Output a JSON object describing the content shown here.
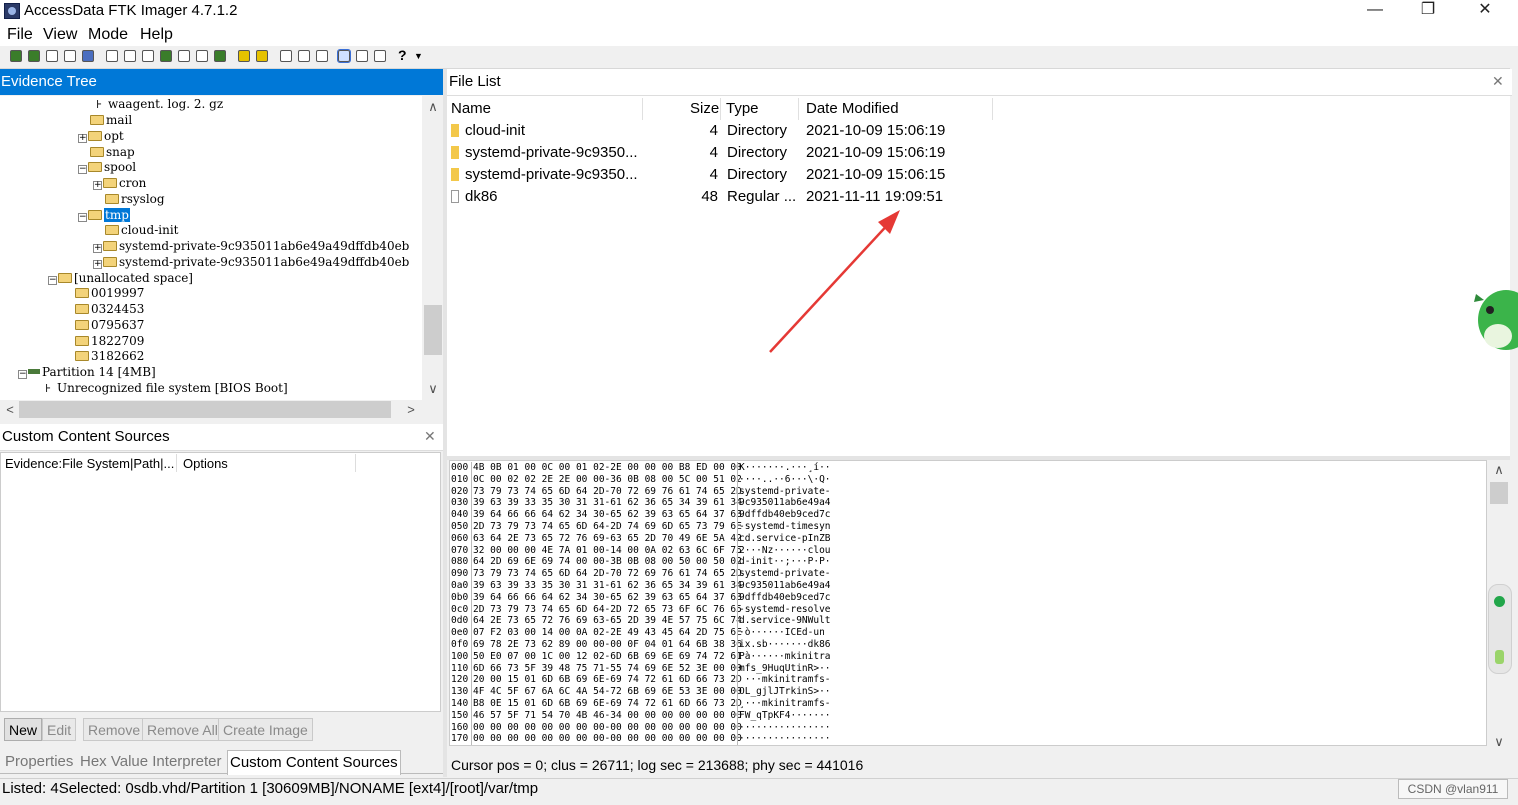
{
  "window": {
    "title": "AccessData FTK Imager 4.7.1.2",
    "minimize": "—",
    "maximize": "❐",
    "close": "✕"
  },
  "menu": [
    "File",
    "View",
    "Mode",
    "Help"
  ],
  "toolbar": {
    "icons": [
      "add-evidence-icon",
      "add-all-evidence-icon",
      "image-mounting-icon",
      "remove-evidence-icon",
      "remove-all-icon",
      "create-image-icon",
      "export-disk-image-icon",
      "export-logical-image-icon",
      "add-custom-content-icon",
      "create-custom-image-icon",
      "decrypt-icon",
      "verify-drive-icon",
      "capture-memory-icon",
      "obtain-protected-files-icon",
      "detect-encryption-icon",
      "export-files-icon",
      "export-hash-list-icon",
      "export-directory-listing-icon",
      "view-files-icon",
      "view-text-icon",
      "view-hex-icon",
      "help-icon"
    ]
  },
  "evidence_tree": {
    "title": "Evidence Tree",
    "nodes": [
      {
        "label": "waagent. log. 2. gz"
      },
      {
        "label": "mail"
      },
      {
        "label": "opt"
      },
      {
        "label": "snap"
      },
      {
        "label": "spool"
      },
      {
        "label": "cron"
      },
      {
        "label": "rsyslog"
      },
      {
        "label": "tmp"
      },
      {
        "label": "cloud-init"
      },
      {
        "label": "systemd-private-9c935011ab6e49a49dffdb40eb"
      },
      {
        "label": "systemd-private-9c935011ab6e49a49dffdb40eb"
      },
      {
        "label": "[unallocated space]"
      },
      {
        "label": "0019997"
      },
      {
        "label": "0324453"
      },
      {
        "label": "0795637"
      },
      {
        "label": "1822709"
      },
      {
        "label": "3182662"
      },
      {
        "label": "Partition 14 [4MB]"
      },
      {
        "label": "Unrecognized file system [BIOS Boot]"
      }
    ]
  },
  "custom_content": {
    "title": "Custom Content Sources",
    "col_evidence": "Evidence:File System|Path|...",
    "col_options": "Options",
    "buttons": [
      "New",
      "Edit",
      "Remove",
      "Remove All",
      "Create Image"
    ],
    "tabs": [
      "Properties",
      "Hex Value Interpreter",
      "Custom Content Sources"
    ]
  },
  "file_list": {
    "title": "File List",
    "columns": [
      "Name",
      "Size",
      "Type",
      "Date Modified"
    ],
    "rows": [
      {
        "name": "cloud-init",
        "size": "4",
        "type": "Directory",
        "modified": "2021-10-09 15:06:19"
      },
      {
        "name": "systemd-private-9c9350...",
        "size": "4",
        "type": "Directory",
        "modified": "2021-10-09 15:06:19"
      },
      {
        "name": "systemd-private-9c9350...",
        "size": "4",
        "type": "Directory",
        "modified": "2021-10-09 15:06:15"
      },
      {
        "name": "dk86",
        "size": "48",
        "type": "Regular ...",
        "modified": "2021-11-11 19:09:51"
      }
    ]
  },
  "hex": [
    {
      "off": "000",
      "bytes": "4B 0B 01 00 0C 00 01 02-2E 00 00 00 B8 ED 00 00",
      "ascii": "K·······.···¸í··"
    },
    {
      "off": "010",
      "bytes": "0C 00 02 02 2E 2E 00 00-36 0B 08 00 5C 00 51 02",
      "ascii": "····..··6···\\·Q·"
    },
    {
      "off": "020",
      "bytes": "73 79 73 74 65 6D 64 2D-70 72 69 76 61 74 65 2D",
      "ascii": "systemd-private-"
    },
    {
      "off": "030",
      "bytes": "39 63 39 33 35 30 31 31-61 62 36 65 34 39 61 34",
      "ascii": "9c935011ab6e49a4"
    },
    {
      "off": "040",
      "bytes": "39 64 66 66 64 62 34 30-65 62 39 63 65 64 37 63",
      "ascii": "9dffdb40eb9ced7c"
    },
    {
      "off": "050",
      "bytes": "2D 73 79 73 74 65 6D 64-2D 74 69 6D 65 73 79 6E",
      "ascii": "-systemd-timesyn"
    },
    {
      "off": "060",
      "bytes": "63 64 2E 73 65 72 76 69-63 65 2D 70 49 6E 5A 42",
      "ascii": "cd.service-pInZB"
    },
    {
      "off": "070",
      "bytes": "32 00 00 00 4E 7A 01 00-14 00 0A 02 63 6C 6F 75",
      "ascii": "2···Nz······clou"
    },
    {
      "off": "080",
      "bytes": "64 2D 69 6E 69 74 00 00-3B 0B 08 00 50 00 50 02",
      "ascii": "d-init··;···P·P·"
    },
    {
      "off": "090",
      "bytes": "73 79 73 74 65 6D 64 2D-70 72 69 76 61 74 65 2D",
      "ascii": "systemd-private-"
    },
    {
      "off": "0a0",
      "bytes": "39 63 39 33 35 30 31 31-61 62 36 65 34 39 61 34",
      "ascii": "9c935011ab6e49a4"
    },
    {
      "off": "0b0",
      "bytes": "39 64 66 66 64 62 34 30-65 62 39 63 65 64 37 63",
      "ascii": "9dffdb40eb9ced7c"
    },
    {
      "off": "0c0",
      "bytes": "2D 73 79 73 74 65 6D 64-2D 72 65 73 6F 6C 76 65",
      "ascii": "-systemd-resolve"
    },
    {
      "off": "0d0",
      "bytes": "64 2E 73 65 72 76 69 63-65 2D 39 4E 57 75 6C 74",
      "ascii": "d.service-9NWult"
    },
    {
      "off": "0e0",
      "bytes": "07 F2 03 00 14 00 0A 02-2E 49 43 45 64 2D 75 6E",
      "ascii": "·ò······ICEd-un"
    },
    {
      "off": "0f0",
      "bytes": "69 78 2E 73 62 89 00 00-00 0F 04 01 64 6B 38 36",
      "ascii": "ix.sb·······dk86"
    },
    {
      "off": "100",
      "bytes": "50 E0 07 00 1C 00 12 02-6D 6B 69 6E 69 74 72 61",
      "ascii": "Pà······mkinitra"
    },
    {
      "off": "110",
      "bytes": "6D 66 73 5F 39 48 75 71-55 74 69 6E 52 3E 00 00",
      "ascii": "mfs_9HuqUtinR>··"
    },
    {
      "off": "120",
      "bytes": "20 00 15 01 6D 6B 69 6E-69 74 72 61 6D 66 73 2D",
      "ascii": " ···mkinitramfs-"
    },
    {
      "off": "130",
      "bytes": "4F 4C 5F 67 6A 6C 4A 54-72 6B 69 6E 53 3E 00 00",
      "ascii": "OL_gjlJTrkinS>··"
    },
    {
      "off": "140",
      "bytes": "B8 0E 15 01 6D 6B 69 6E-69 74 72 61 6D 66 73 2D",
      "ascii": "¸···mkinitramfs-"
    },
    {
      "off": "150",
      "bytes": "46 57 5F 71 54 70 4B 46-34 00 00 00 00 00 00 00",
      "ascii": "FW_qTpKF4·······"
    },
    {
      "off": "160",
      "bytes": "00 00 00 00 00 00 00 00-00 00 00 00 00 00 00 00",
      "ascii": "················"
    },
    {
      "off": "170",
      "bytes": "00 00 00 00 00 00 00 00-00 00 00 00 00 00 00 00",
      "ascii": "················"
    }
  ],
  "hex_status": "Cursor pos = 0; clus = 26711; log sec = 213688; phy sec = 441016",
  "status_bar": "Listed: 4Selected: 0sdb.vhd/Partition 1 [30609MB]/NONAME [ext4]/[root]/var/tmp",
  "watermark": "CSDN @vlan911",
  "colors": {
    "accent": "#0078d7",
    "arrow": "#e53935"
  }
}
